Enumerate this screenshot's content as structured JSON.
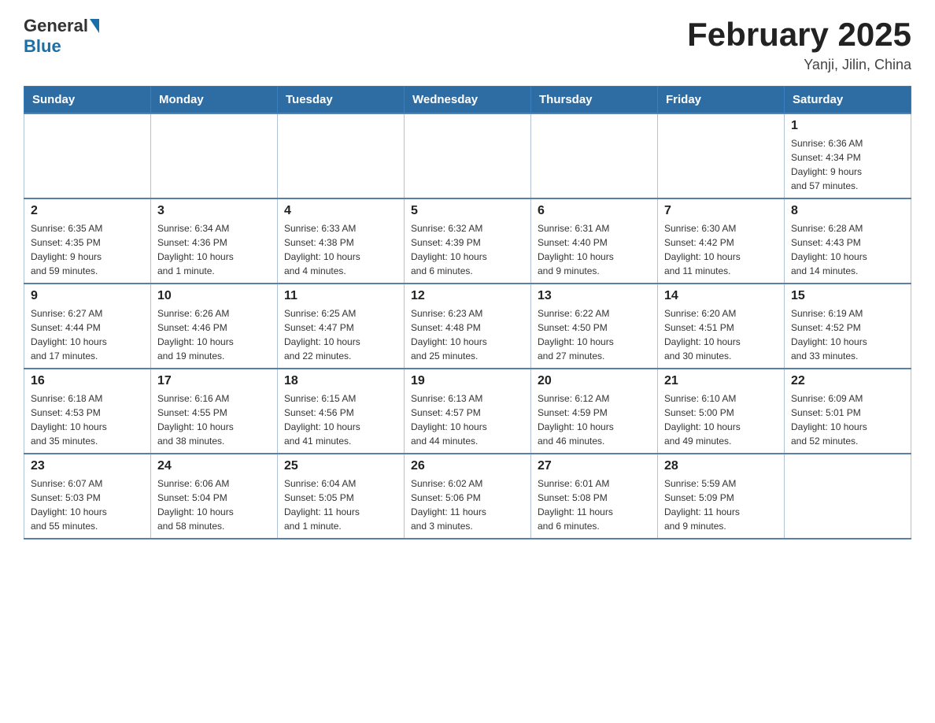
{
  "header": {
    "logo_general": "General",
    "logo_blue": "Blue",
    "month_title": "February 2025",
    "subtitle": "Yanji, Jilin, China"
  },
  "days_of_week": [
    "Sunday",
    "Monday",
    "Tuesday",
    "Wednesday",
    "Thursday",
    "Friday",
    "Saturday"
  ],
  "weeks": [
    {
      "days": [
        {
          "number": "",
          "info": ""
        },
        {
          "number": "",
          "info": ""
        },
        {
          "number": "",
          "info": ""
        },
        {
          "number": "",
          "info": ""
        },
        {
          "number": "",
          "info": ""
        },
        {
          "number": "",
          "info": ""
        },
        {
          "number": "1",
          "info": "Sunrise: 6:36 AM\nSunset: 4:34 PM\nDaylight: 9 hours\nand 57 minutes."
        }
      ]
    },
    {
      "days": [
        {
          "number": "2",
          "info": "Sunrise: 6:35 AM\nSunset: 4:35 PM\nDaylight: 9 hours\nand 59 minutes."
        },
        {
          "number": "3",
          "info": "Sunrise: 6:34 AM\nSunset: 4:36 PM\nDaylight: 10 hours\nand 1 minute."
        },
        {
          "number": "4",
          "info": "Sunrise: 6:33 AM\nSunset: 4:38 PM\nDaylight: 10 hours\nand 4 minutes."
        },
        {
          "number": "5",
          "info": "Sunrise: 6:32 AM\nSunset: 4:39 PM\nDaylight: 10 hours\nand 6 minutes."
        },
        {
          "number": "6",
          "info": "Sunrise: 6:31 AM\nSunset: 4:40 PM\nDaylight: 10 hours\nand 9 minutes."
        },
        {
          "number": "7",
          "info": "Sunrise: 6:30 AM\nSunset: 4:42 PM\nDaylight: 10 hours\nand 11 minutes."
        },
        {
          "number": "8",
          "info": "Sunrise: 6:28 AM\nSunset: 4:43 PM\nDaylight: 10 hours\nand 14 minutes."
        }
      ]
    },
    {
      "days": [
        {
          "number": "9",
          "info": "Sunrise: 6:27 AM\nSunset: 4:44 PM\nDaylight: 10 hours\nand 17 minutes."
        },
        {
          "number": "10",
          "info": "Sunrise: 6:26 AM\nSunset: 4:46 PM\nDaylight: 10 hours\nand 19 minutes."
        },
        {
          "number": "11",
          "info": "Sunrise: 6:25 AM\nSunset: 4:47 PM\nDaylight: 10 hours\nand 22 minutes."
        },
        {
          "number": "12",
          "info": "Sunrise: 6:23 AM\nSunset: 4:48 PM\nDaylight: 10 hours\nand 25 minutes."
        },
        {
          "number": "13",
          "info": "Sunrise: 6:22 AM\nSunset: 4:50 PM\nDaylight: 10 hours\nand 27 minutes."
        },
        {
          "number": "14",
          "info": "Sunrise: 6:20 AM\nSunset: 4:51 PM\nDaylight: 10 hours\nand 30 minutes."
        },
        {
          "number": "15",
          "info": "Sunrise: 6:19 AM\nSunset: 4:52 PM\nDaylight: 10 hours\nand 33 minutes."
        }
      ]
    },
    {
      "days": [
        {
          "number": "16",
          "info": "Sunrise: 6:18 AM\nSunset: 4:53 PM\nDaylight: 10 hours\nand 35 minutes."
        },
        {
          "number": "17",
          "info": "Sunrise: 6:16 AM\nSunset: 4:55 PM\nDaylight: 10 hours\nand 38 minutes."
        },
        {
          "number": "18",
          "info": "Sunrise: 6:15 AM\nSunset: 4:56 PM\nDaylight: 10 hours\nand 41 minutes."
        },
        {
          "number": "19",
          "info": "Sunrise: 6:13 AM\nSunset: 4:57 PM\nDaylight: 10 hours\nand 44 minutes."
        },
        {
          "number": "20",
          "info": "Sunrise: 6:12 AM\nSunset: 4:59 PM\nDaylight: 10 hours\nand 46 minutes."
        },
        {
          "number": "21",
          "info": "Sunrise: 6:10 AM\nSunset: 5:00 PM\nDaylight: 10 hours\nand 49 minutes."
        },
        {
          "number": "22",
          "info": "Sunrise: 6:09 AM\nSunset: 5:01 PM\nDaylight: 10 hours\nand 52 minutes."
        }
      ]
    },
    {
      "days": [
        {
          "number": "23",
          "info": "Sunrise: 6:07 AM\nSunset: 5:03 PM\nDaylight: 10 hours\nand 55 minutes."
        },
        {
          "number": "24",
          "info": "Sunrise: 6:06 AM\nSunset: 5:04 PM\nDaylight: 10 hours\nand 58 minutes."
        },
        {
          "number": "25",
          "info": "Sunrise: 6:04 AM\nSunset: 5:05 PM\nDaylight: 11 hours\nand 1 minute."
        },
        {
          "number": "26",
          "info": "Sunrise: 6:02 AM\nSunset: 5:06 PM\nDaylight: 11 hours\nand 3 minutes."
        },
        {
          "number": "27",
          "info": "Sunrise: 6:01 AM\nSunset: 5:08 PM\nDaylight: 11 hours\nand 6 minutes."
        },
        {
          "number": "28",
          "info": "Sunrise: 5:59 AM\nSunset: 5:09 PM\nDaylight: 11 hours\nand 9 minutes."
        },
        {
          "number": "",
          "info": ""
        }
      ]
    }
  ]
}
